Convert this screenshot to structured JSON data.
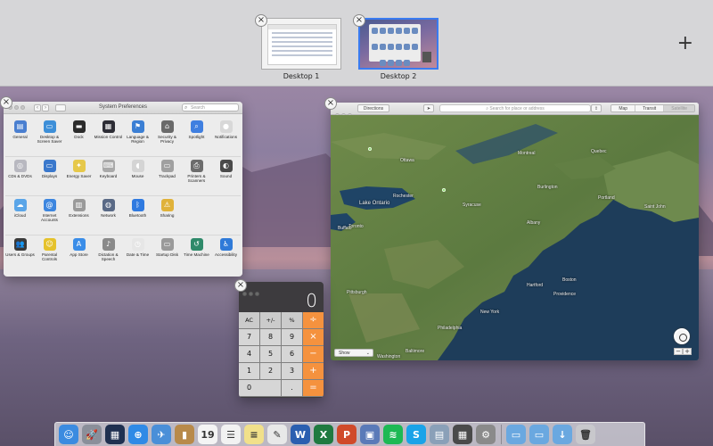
{
  "spaces": {
    "desktops": [
      {
        "label": "Desktop 1"
      },
      {
        "label": "Desktop 2"
      }
    ],
    "close_symbol": "×",
    "add_symbol": "+"
  },
  "system_preferences": {
    "title": "System Preferences",
    "search_placeholder": "Search",
    "nav_back": "‹",
    "nav_forward": "›",
    "rows": [
      [
        {
          "label": "General",
          "icon": "general-icon",
          "color": "#4a7fd0",
          "glyph": "▤"
        },
        {
          "label": "Desktop & Screen Saver",
          "icon": "desktop-screensaver-icon",
          "color": "#3d8fd8",
          "glyph": "▭"
        },
        {
          "label": "Dock",
          "icon": "dock-icon",
          "color": "#2b2b2b",
          "glyph": "▬"
        },
        {
          "label": "Mission Control",
          "icon": "mission-control-icon",
          "color": "#2d2d35",
          "glyph": "▦"
        },
        {
          "label": "Language & Region",
          "icon": "language-region-icon",
          "color": "#3b7fd4",
          "glyph": "⚑"
        },
        {
          "label": "Security & Privacy",
          "icon": "security-privacy-icon",
          "color": "#6a6a6a",
          "glyph": "⌂"
        },
        {
          "label": "Spotlight",
          "icon": "spotlight-icon",
          "color": "#3f7fe0",
          "glyph": "⌕"
        },
        {
          "label": "Notifications",
          "icon": "notifications-icon",
          "color": "#d8d8d8",
          "glyph": "●"
        }
      ],
      [
        {
          "label": "CDs & DVDs",
          "icon": "cds-dvds-icon",
          "color": "#b8b8c0",
          "glyph": "◎"
        },
        {
          "label": "Displays",
          "icon": "displays-icon",
          "color": "#3a78cc",
          "glyph": "▭"
        },
        {
          "label": "Energy Saver",
          "icon": "energy-saver-icon",
          "color": "#e6c84a",
          "glyph": "✦"
        },
        {
          "label": "Keyboard",
          "icon": "keyboard-icon",
          "color": "#a9a9a9",
          "glyph": "⌨"
        },
        {
          "label": "Mouse",
          "icon": "mouse-icon",
          "color": "#d4d4d4",
          "glyph": "◖"
        },
        {
          "label": "Trackpad",
          "icon": "trackpad-icon",
          "color": "#a0a0a0",
          "glyph": "▭"
        },
        {
          "label": "Printers & Scanners",
          "icon": "printers-scanners-icon",
          "color": "#6c6c6c",
          "glyph": "⎙"
        },
        {
          "label": "Sound",
          "icon": "sound-icon",
          "color": "#4a4a4a",
          "glyph": "◐"
        }
      ],
      [
        {
          "label": "iCloud",
          "icon": "icloud-icon",
          "color": "#5aa5e8",
          "glyph": "☁"
        },
        {
          "label": "Internet Accounts",
          "icon": "internet-accounts-icon",
          "color": "#3d86df",
          "glyph": "@"
        },
        {
          "label": "Extensions",
          "icon": "extensions-icon",
          "color": "#9a9a9a",
          "glyph": "▥"
        },
        {
          "label": "Network",
          "icon": "network-icon",
          "color": "#5a6a86",
          "glyph": "◍"
        },
        {
          "label": "Bluetooth",
          "icon": "bluetooth-icon",
          "color": "#2f7ae0",
          "glyph": "ᛒ"
        },
        {
          "label": "Sharing",
          "icon": "sharing-icon",
          "color": "#e0b23a",
          "glyph": "⚠"
        }
      ],
      [
        {
          "label": "Users & Groups",
          "icon": "users-groups-icon",
          "color": "#3a3a3a",
          "glyph": "👥"
        },
        {
          "label": "Parental Controls",
          "icon": "parental-controls-icon",
          "color": "#e5c22c",
          "glyph": "☺"
        },
        {
          "label": "App Store",
          "icon": "app-store-icon",
          "color": "#3a8de8",
          "glyph": "A"
        },
        {
          "label": "Dictation & Speech",
          "icon": "dictation-speech-icon",
          "color": "#8a8a8a",
          "glyph": "♪"
        },
        {
          "label": "Date & Time",
          "icon": "date-time-icon",
          "color": "#e6e6e6",
          "glyph": "◷"
        },
        {
          "label": "Startup Disk",
          "icon": "startup-disk-icon",
          "color": "#9a9a9a",
          "glyph": "▭"
        },
        {
          "label": "Time Machine",
          "icon": "time-machine-icon",
          "color": "#2f8a6a",
          "glyph": "↺"
        },
        {
          "label": "Accessibility",
          "icon": "accessibility-icon",
          "color": "#2f7ad8",
          "glyph": "♿"
        }
      ]
    ]
  },
  "maps": {
    "directions_label": "Directions",
    "search_placeholder": "Search for place or address",
    "view_modes": [
      "Map",
      "Transit",
      "Satellite"
    ],
    "show_label": "Show",
    "zoom_out": "−",
    "zoom_in": "+",
    "labels": [
      {
        "text": "Lake Ontario"
      },
      {
        "text": "Ottawa"
      },
      {
        "text": "Montreal"
      },
      {
        "text": "Toronto"
      },
      {
        "text": "Buffalo"
      },
      {
        "text": "Rochester"
      },
      {
        "text": "Syracuse"
      },
      {
        "text": "Albany"
      },
      {
        "text": "Burlington"
      },
      {
        "text": "Portland"
      },
      {
        "text": "Boston"
      },
      {
        "text": "Providence"
      },
      {
        "text": "Hartford"
      },
      {
        "text": "New York"
      },
      {
        "text": "Philadelphia"
      },
      {
        "text": "Pittsburgh"
      },
      {
        "text": "Baltimore"
      },
      {
        "text": "Washington"
      },
      {
        "text": "Quebec"
      },
      {
        "text": "Saint John"
      }
    ]
  },
  "calculator": {
    "display": "0",
    "keys": [
      {
        "label": "AC",
        "type": "fn"
      },
      {
        "label": "+/-",
        "type": "fn"
      },
      {
        "label": "%",
        "type": "fn"
      },
      {
        "label": "÷",
        "type": "op"
      },
      {
        "label": "7",
        "type": "num"
      },
      {
        "label": "8",
        "type": "num"
      },
      {
        "label": "9",
        "type": "num"
      },
      {
        "label": "×",
        "type": "op"
      },
      {
        "label": "4",
        "type": "num"
      },
      {
        "label": "5",
        "type": "num"
      },
      {
        "label": "6",
        "type": "num"
      },
      {
        "label": "−",
        "type": "op"
      },
      {
        "label": "1",
        "type": "num"
      },
      {
        "label": "2",
        "type": "num"
      },
      {
        "label": "3",
        "type": "num"
      },
      {
        "label": "+",
        "type": "op"
      },
      {
        "label": "0",
        "type": "zero"
      },
      {
        "label": ".",
        "type": "num"
      },
      {
        "label": "=",
        "type": "op"
      }
    ]
  },
  "dock": {
    "apps": [
      {
        "name": "finder-icon",
        "color": "#3b8be0",
        "glyph": "☺"
      },
      {
        "name": "launchpad-icon",
        "color": "#8a8f9a",
        "glyph": "🚀"
      },
      {
        "name": "mission-control-icon",
        "color": "#1f3050",
        "glyph": "▦"
      },
      {
        "name": "safari-icon",
        "color": "#2f8ae6",
        "glyph": "⊕"
      },
      {
        "name": "mail-icon",
        "color": "#4a8fd8",
        "glyph": "✈"
      },
      {
        "name": "contacts-icon",
        "color": "#b88a4a",
        "glyph": "▮"
      },
      {
        "name": "calendar-icon",
        "color": "#f4f4f4",
        "glyph": "19"
      },
      {
        "name": "reminders-icon",
        "color": "#f2f2f2",
        "glyph": "☰"
      },
      {
        "name": "notes-icon",
        "color": "#f1e08a",
        "glyph": "≡"
      },
      {
        "name": "textedit-icon",
        "color": "#e8e8e8",
        "glyph": "✎"
      },
      {
        "name": "word-icon",
        "color": "#2b5fb0",
        "glyph": "W"
      },
      {
        "name": "excel-icon",
        "color": "#1f7a40",
        "glyph": "X"
      },
      {
        "name": "powerpoint-icon",
        "color": "#d04a2a",
        "glyph": "P"
      },
      {
        "name": "preview-icon",
        "color": "#5a7ab8",
        "glyph": "▣"
      },
      {
        "name": "spotify-icon",
        "color": "#1db954",
        "glyph": "≋"
      },
      {
        "name": "skype-icon",
        "color": "#1aa3e8",
        "glyph": "S"
      },
      {
        "name": "archive-utility-icon",
        "color": "#8aa0b8",
        "glyph": "▤"
      },
      {
        "name": "calculator-icon",
        "color": "#4a4a4a",
        "glyph": "▦"
      },
      {
        "name": "system-preferences-icon",
        "color": "#8a8a8a",
        "glyph": "⚙"
      }
    ],
    "stacks": [
      {
        "name": "applications-folder-icon",
        "color": "#6aa8e0",
        "glyph": "▭"
      },
      {
        "name": "documents-folder-icon",
        "color": "#6aa8e0",
        "glyph": "▭"
      },
      {
        "name": "downloads-folder-icon",
        "color": "#6aa8e0",
        "glyph": "↓"
      },
      {
        "name": "trash-icon",
        "color": "#c8c8cc",
        "glyph": "🗑"
      }
    ]
  }
}
